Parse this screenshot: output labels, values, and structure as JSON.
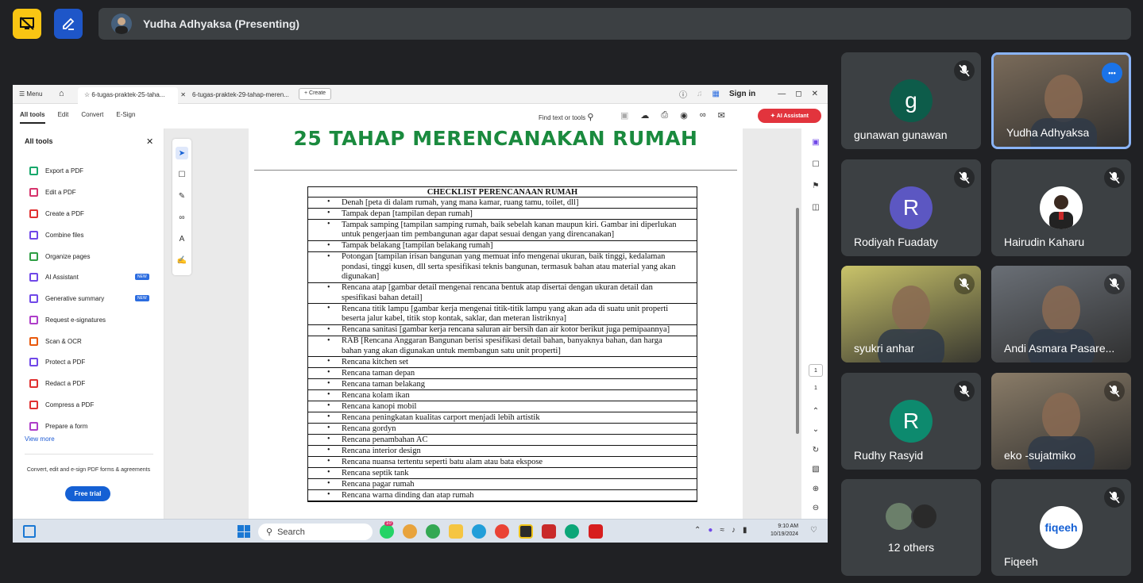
{
  "meeting": {
    "presenter_label": "Yudha Adhyaksa (Presenting)"
  },
  "acrobat": {
    "menu_label": "Menu",
    "tabs": [
      {
        "label": "6-tugas-praktek-25-taha..."
      },
      {
        "label": "6-tugas-praktek-29-tahap-meren..."
      }
    ],
    "create_label": "Create",
    "signin_label": "Sign in",
    "nav": [
      "All tools",
      "Edit",
      "Convert",
      "E-Sign"
    ],
    "find_label": "Find text or tools",
    "ai_assistant_label": "AI Assistant",
    "panel": {
      "title": "All tools",
      "items": [
        {
          "label": "Export a PDF",
          "color": "#18a86b",
          "badge": ""
        },
        {
          "label": "Edit a PDF",
          "color": "#d6336c",
          "badge": ""
        },
        {
          "label": "Create a PDF",
          "color": "#e03131",
          "badge": ""
        },
        {
          "label": "Combine files",
          "color": "#7048e8",
          "badge": ""
        },
        {
          "label": "Organize pages",
          "color": "#2f9e44",
          "badge": ""
        },
        {
          "label": "AI Assistant",
          "color": "#7048e8",
          "badge": "NEW"
        },
        {
          "label": "Generative summary",
          "color": "#7048e8",
          "badge": "NEW"
        },
        {
          "label": "Request e-signatures",
          "color": "#ae3ec9",
          "badge": ""
        },
        {
          "label": "Scan & OCR",
          "color": "#e8590c",
          "badge": ""
        },
        {
          "label": "Protect a PDF",
          "color": "#7048e8",
          "badge": ""
        },
        {
          "label": "Redact a PDF",
          "color": "#e03131",
          "badge": ""
        },
        {
          "label": "Compress a PDF",
          "color": "#e03131",
          "badge": ""
        },
        {
          "label": "Prepare a form",
          "color": "#ae3ec9",
          "badge": ""
        }
      ],
      "view_more": "View more",
      "promo_text": "Convert, edit and e-sign PDF forms & agreements",
      "trial_label": "Free trial"
    },
    "page_number": "1",
    "page_total": "1"
  },
  "document": {
    "heading": "25 TAHAP MERENCANAKAN RUMAH",
    "checklist_title": "CHECKLIST PERENCANAAN RUMAH",
    "items": [
      "Denah [peta di dalam rumah, yang mana kamar, ruang tamu, toilet, dll]",
      "Tampak depan [tampilan depan rumah]",
      "Tampak samping [tampilan samping rumah, baik sebelah kanan maupun kiri. Gambar ini diperlukan untuk pengerjaan tim pembangunan agar dapat sesuai dengan yang direncanakan]",
      "Tampak belakang [tampilan belakang rumah]",
      "Potongan [tampilan irisan bangunan yang memuat info mengenai ukuran, baik tinggi, kedalaman pondasi, tinggi kusen, dll serta spesifikasi teknis bangunan, termasuk bahan atau material yang akan digunakan]",
      "Rencana atap [gambar detail mengenai rencana bentuk atap disertai dengan ukuran detail dan spesifikasi bahan detail]",
      "Rencana titik lampu [gambar kerja mengenai titik-titik lampu yang akan ada di suatu unit properti beserta jalur kabel, titik stop kontak, saklar, dan meteran listriknya]",
      "Rencana sanitasi [gambar kerja rencana saluran air bersih dan air kotor berikut juga pemipaannya]",
      "RAB [Rencana Anggaran Bangunan berisi spesifikasi detail bahan, banyaknya bahan, dan harga bahan yang akan digunakan untuk membangun satu unit properti]",
      "Rencana kitchen set",
      "Rencana taman depan",
      "Rencana taman belakang",
      "Rencana kolam ikan",
      "Rencana kanopi mobil",
      "Rencana peningkatan kualitas carport menjadi lebih artistik",
      "Rencana gordyn",
      "Rencana penambahan AC",
      "Rencana interior design",
      "Rencana nuansa tertentu seperti batu alam atau bata ekspose",
      "Rencana septik tank",
      "Rencana pagar rumah",
      "Rencana warna dinding dan atap rumah"
    ]
  },
  "taskbar": {
    "search_label": "Search",
    "time": "9:10 AM",
    "date": "10/19/2024",
    "badge": "10"
  },
  "participants": [
    {
      "name": "gunawan gunawan",
      "initial": "g",
      "color": "#0d5c4a",
      "type": "avatar"
    },
    {
      "name": "Yudha Adhyaksa",
      "initial": "",
      "color": "#7a6b5a",
      "type": "video"
    },
    {
      "name": "Rodiyah Fuadaty",
      "initial": "R",
      "color": "#5c57c2",
      "type": "avatar"
    },
    {
      "name": "Hairudin Kaharu",
      "initial": "",
      "color": "#ffffff",
      "type": "photo"
    },
    {
      "name": "syukri anhar",
      "initial": "",
      "color": "#c9c36a",
      "type": "video"
    },
    {
      "name": "Andi Asmara Pasare...",
      "initial": "",
      "color": "#6a6f76",
      "type": "video"
    },
    {
      "name": "Rudhy Rasyid",
      "initial": "R",
      "color": "#0d8a6e",
      "type": "avatar"
    },
    {
      "name": "eko -sujatmiko",
      "initial": "",
      "color": "#8a7c68",
      "type": "video"
    },
    {
      "name": "12 others",
      "initial": "",
      "color": "#3c4043",
      "type": "group"
    },
    {
      "name": "Fiqeeh",
      "initial": "fiqeeh",
      "color": "#ffffff",
      "type": "logo"
    }
  ]
}
